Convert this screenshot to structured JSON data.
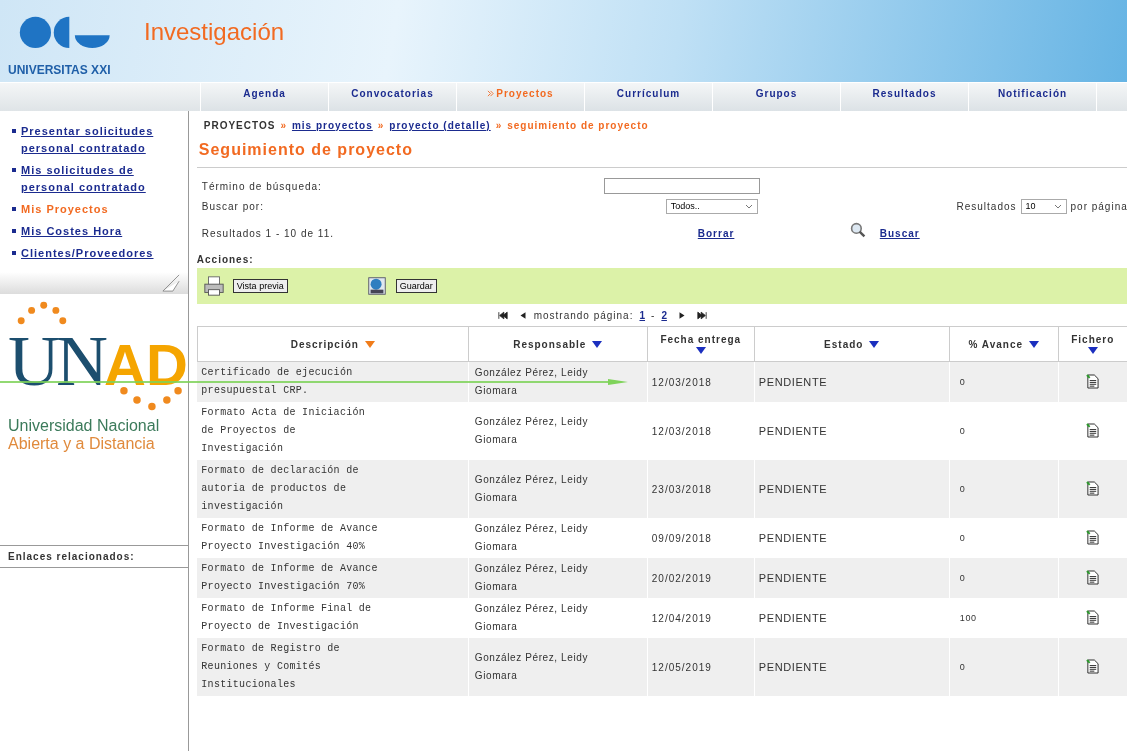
{
  "header": {
    "brand": "UNIVERSITAS XXI",
    "title": "Investigación"
  },
  "tabs": [
    {
      "label": "Agenda",
      "selected": false
    },
    {
      "label": "Convocatorias",
      "selected": false
    },
    {
      "label": "Proyectos",
      "selected": true
    },
    {
      "label": "Currículum",
      "selected": false
    },
    {
      "label": "Grupos",
      "selected": false
    },
    {
      "label": "Resultados",
      "selected": false
    },
    {
      "label": "Notificación",
      "selected": false
    }
  ],
  "sidebar": {
    "items": [
      {
        "label": "Presentar solicitudes personal contratado",
        "selected": false
      },
      {
        "label": "Mis solicitudes de personal contratado",
        "selected": false
      },
      {
        "label": "Mis Proyectos",
        "selected": true
      },
      {
        "label": "Mis Costes Hora",
        "selected": false
      },
      {
        "label": "Clientes/Proveedores",
        "selected": false
      }
    ],
    "logo": {
      "mark_a": "UN",
      "mark_b": "AD",
      "line1": "Universidad Nacional",
      "line2": "Abierta y a  Distancia"
    },
    "related_links": "Enlaces relacionados:"
  },
  "breadcrumb": {
    "separator": "»",
    "items": [
      {
        "label": "PROYECTOS",
        "kind": "root"
      },
      {
        "label": "mis proyectos",
        "kind": "link"
      },
      {
        "label": "proyecto (detalle)",
        "kind": "link"
      },
      {
        "label": "seguimiento de proyecto",
        "kind": "current"
      }
    ]
  },
  "page_title": "Seguimiento de proyecto",
  "search": {
    "term_label": "Término de búsqueda:",
    "by_label": "Buscar por:",
    "by_value": "Todos..",
    "results_label": "Resultados",
    "per_page_value": "10",
    "per_page_label": "por página",
    "summary": "Resultados 1 - 10 de 11.",
    "clear": "Borrar",
    "search": "Buscar"
  },
  "actions": {
    "label": "Acciones:",
    "buttons": [
      {
        "label": "Vista previa",
        "kind": "print"
      },
      {
        "label": "Guardar",
        "kind": "save"
      }
    ]
  },
  "pagination": {
    "label": "mostrando página:",
    "pages": [
      "1",
      "2"
    ],
    "separator": "-"
  },
  "table": {
    "columns": [
      {
        "label": "Descripción",
        "sorted": true
      },
      {
        "label": "Responsable",
        "sorted": false
      },
      {
        "label": "Fecha entrega",
        "sorted": false
      },
      {
        "label": "Estado",
        "sorted": false
      },
      {
        "label": "% Avance",
        "sorted": false
      },
      {
        "label": "Fichero",
        "sorted": false
      }
    ],
    "rows": [
      {
        "descripcion": "Certificado de ejecución presupuestal CRP.",
        "responsable": "González Pérez, Leidy Giomara",
        "fecha": "12/03/2018",
        "estado": "PENDIENTE",
        "avance": "0"
      },
      {
        "descripcion": "Formato Acta de Iniciación de Proyectos de Investigación",
        "responsable": "González Pérez, Leidy Giomara",
        "fecha": "12/03/2018",
        "estado": "PENDIENTE",
        "avance": "0"
      },
      {
        "descripcion": "Formato de declaración de autoria de productos de investigación",
        "responsable": "González Pérez, Leidy Giomara",
        "fecha": "23/03/2018",
        "estado": "PENDIENTE",
        "avance": "0"
      },
      {
        "descripcion": "Formato de Informe de Avance Proyecto Investigación 40%",
        "responsable": "González Pérez, Leidy Giomara",
        "fecha": "09/09/2018",
        "estado": "PENDIENTE",
        "avance": "0"
      },
      {
        "descripcion": "Formato de Informe de Avance Proyecto Investigación 70%",
        "responsable": "González Pérez, Leidy Giomara",
        "fecha": "20/02/2019",
        "estado": "PENDIENTE",
        "avance": "0"
      },
      {
        "descripcion": "Formato de Informe Final de Proyecto de Investigación",
        "responsable": "González Pérez, Leidy Giomara",
        "fecha": "12/04/2019",
        "estado": "PENDIENTE",
        "avance": "100"
      },
      {
        "descripcion": "Formato de Registro de Reuniones y Comités Institucionales",
        "responsable": "González Pérez, Leidy Giomara",
        "fecha": "12/05/2019",
        "estado": "PENDIENTE",
        "avance": "0"
      }
    ]
  }
}
